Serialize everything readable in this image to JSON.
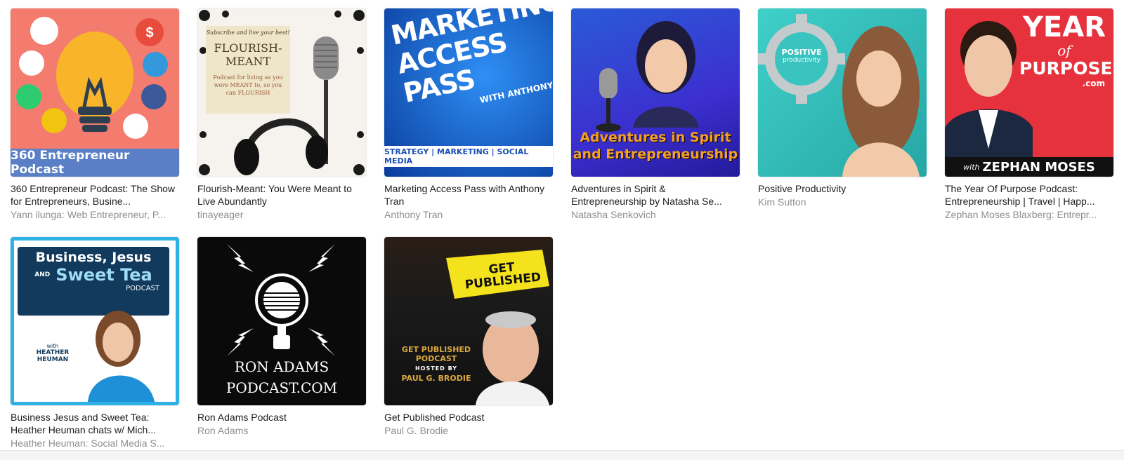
{
  "podcasts": [
    {
      "title": "360 Entrepreneur Podcast: The Show for Entrepreneurs, Busine...",
      "author": "Yann ilunga: Web Entrepreneur, P...",
      "art_text": "360 Entrepreneur Podcast",
      "colors": {
        "bg": "#f47c6f",
        "band": "#5b7fc7",
        "bulb": "#f8b52a"
      }
    },
    {
      "title": "Flourish-Meant: You Were Meant to Live Abundantly",
      "author": "tinayeager",
      "art_text": {
        "top": "Subscribe and live your best!",
        "name": "FLOURISH-MEANT",
        "sub": "Podcast for living as you were MEANT to, so you can FLOURISH"
      },
      "colors": {
        "bg": "#f6f3ee",
        "card": "#efe6c9"
      }
    },
    {
      "title": "Marketing Access Pass with Anthony Tran",
      "author": "Anthony Tran",
      "art_text": {
        "l1": "MARKETING",
        "l2": "ACCESS PASS",
        "with": "WITH ANTHONY TRAN",
        "band": "STRATEGY | MARKETING | SOCIAL MEDIA"
      },
      "colors": {
        "bg": "#1565d8",
        "band": "#ffffff",
        "band_text": "#1a4fb5"
      }
    },
    {
      "title": "Adventures in Spirit & Entrepreneurship by Natasha Se...",
      "author": "Natasha Senkovich",
      "art_text": {
        "l1": "Adventures in Spirit",
        "l2": "and Entrepreneurship"
      },
      "colors": {
        "bg": "#3c2fd0",
        "text": "#f6a021"
      }
    },
    {
      "title": "Positive Productivity",
      "author": "Kim Sutton",
      "art_text": {
        "l1": "POSITIVE",
        "l2": "productivity"
      },
      "colors": {
        "bg": "#36c3c0",
        "gear": "#bfc4c8"
      }
    },
    {
      "title": "The Year Of Purpose Podcast: Entrepreneurship | Travel | Happ...",
      "author": "Zephan Moses Blaxberg: Entrepr...",
      "art_text": {
        "year": "YEAR",
        "of": "of",
        "purpose": "PURPOSE",
        "com": ".com",
        "with": "with",
        "name": "ZEPHAN MOSES"
      },
      "colors": {
        "bg": "#e6323d",
        "band": "#111111"
      }
    },
    {
      "title": "Business Jesus and Sweet Tea: Heather Heuman chats w/ Mich...",
      "author": "Heather Heuman: Social Media S...",
      "art_text": {
        "l1": "Business, Jesus",
        "and": "AND",
        "l2": "Sweet Tea",
        "podcast": "PODCAST",
        "with": "with",
        "name": "HEATHER HEUMAN"
      },
      "colors": {
        "frame": "#2fb1e6",
        "panel": "#123a5c",
        "accent": "#2fb1e6"
      }
    },
    {
      "title": "Ron Adams Podcast",
      "author": "Ron Adams",
      "art_text": {
        "l1": "RON ADAMS",
        "l2": "PODCAST.COM"
      },
      "colors": {
        "bg": "#0a0a0a",
        "fg": "#ffffff"
      }
    },
    {
      "title": "Get Published Podcast",
      "author": "Paul G. Brodie",
      "art_text": {
        "badge": "GET PUBLISHED",
        "l1": "GET PUBLISHED PODCAST",
        "l2": "HOSTED BY",
        "l3": "PAUL G. BRODIE"
      },
      "colors": {
        "bg": "#1a1a1a",
        "badge": "#f4e21c",
        "gold": "#d9a640"
      }
    }
  ]
}
